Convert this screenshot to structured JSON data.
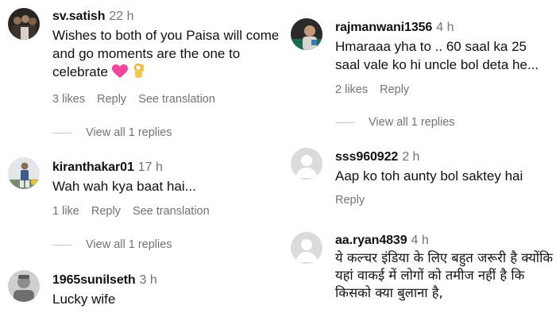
{
  "left_column": {
    "comments": [
      {
        "username": "sv.satish",
        "time": "22 h",
        "text": "Wishes to both of you Paisa will come and go moments are the one to celebrate",
        "emojis": [
          "pink-heart-icon",
          "ok-hand-icon"
        ],
        "likes": "3 likes",
        "reply": "Reply",
        "translate": "See translation",
        "view_replies": "View all 1 replies"
      },
      {
        "username": "kiranthakar01",
        "time": "17 h",
        "text": "Wah wah kya baat hai...",
        "likes": "1 like",
        "reply": "Reply",
        "translate": "See translation",
        "view_replies": "View all 1 replies"
      },
      {
        "username": "1965sunilseth",
        "time": "3 h",
        "text": "Lucky wife"
      }
    ]
  },
  "right_column": {
    "comments": [
      {
        "username": "rajmanwani1356",
        "time": "4 h",
        "text": "Hmaraaa yha to .. 60 saal ka 25 saal vale ko hi uncle bol deta he...",
        "likes": "2 likes",
        "reply": "Reply",
        "view_replies": "View all 1 replies"
      },
      {
        "username": "sss960922",
        "time": "2 h",
        "text": "Aap ko toh aunty bol saktey hai",
        "reply": "Reply"
      },
      {
        "username": "aa.ryan4839",
        "time": "4 h",
        "text": "ये कल्चर इंडिया के लिए बहुत जरूरी है क्योंकि यहां वाकई में लोगों को तमीज नहीं है कि किसको क्या बुलाना है,"
      }
    ]
  },
  "colors": {
    "heart": "#f0479a",
    "muted": "#737373",
    "default_avatar_bg": "#dbdbdb"
  }
}
